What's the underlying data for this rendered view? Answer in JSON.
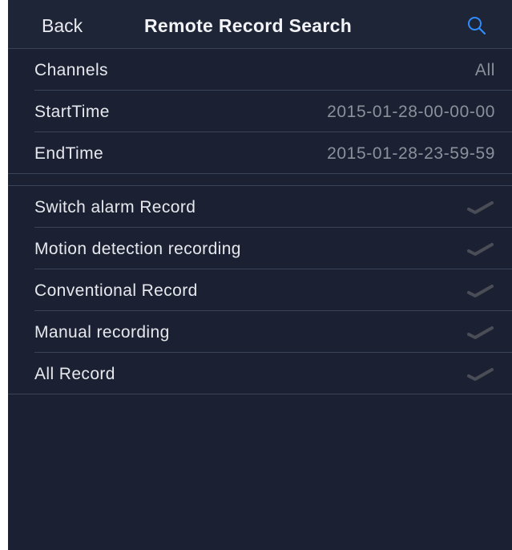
{
  "navbar": {
    "back_label": "Back",
    "title": "Remote Record Search",
    "search_icon": "search-icon",
    "accent_color": "#2f8cff"
  },
  "params": [
    {
      "label": "Channels",
      "value": "All"
    },
    {
      "label": "StartTime",
      "value": "2015-01-28-00-00-00"
    },
    {
      "label": "EndTime",
      "value": "2015-01-28-23-59-59"
    }
  ],
  "record_types": [
    {
      "label": "Switch alarm Record",
      "checked": true
    },
    {
      "label": "Motion detection recording",
      "checked": true
    },
    {
      "label": "Conventional Record",
      "checked": true
    },
    {
      "label": "Manual recording",
      "checked": true
    },
    {
      "label": "All Record",
      "checked": true
    }
  ],
  "colors": {
    "background": "#1b2133",
    "text": "#e6e8ed",
    "value_text": "#8c909b",
    "separator": "#3b4358",
    "checkmark": "#4a4d55"
  }
}
